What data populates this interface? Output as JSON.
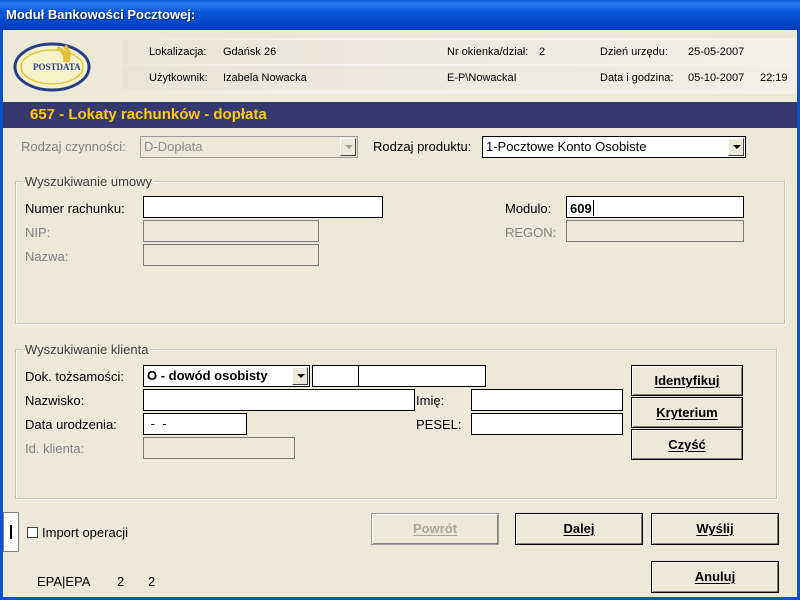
{
  "window": {
    "title": "Moduł Bankowości Pocztowej:"
  },
  "logo": {
    "text": "POSTDATA"
  },
  "header": {
    "lokalizacja_label": "Lokalizacja:",
    "lokalizacja_value": "Gdańsk 26",
    "nr_okienka_label": "Nr okienka/dział:",
    "nr_okienka_value": "2",
    "dzien_urzedu_label": "Dzień urzędu:",
    "dzien_urzedu_value": "25-05-2007",
    "uzytkownik_label": "Użytkownik:",
    "uzytkownik_value": "Izabela Nowacka",
    "login_value": "E-P\\NowackaI",
    "data_godzina_label": "Data i godzina:",
    "data_value": "05-10-2007",
    "godzina_value": "22:19"
  },
  "banner": {
    "title": "657 - Lokaty rachunków - dopłata"
  },
  "top": {
    "rodzaj_czynnosci_label": "Rodzaj czynności:",
    "rodzaj_czynnosci_value": "D-Dopłata",
    "rodzaj_produktu_label": "Rodzaj produktu:",
    "rodzaj_produktu_value": "1-Pocztowe Konto Osobiste"
  },
  "umowa": {
    "title": "Wyszukiwanie umowy",
    "numer_rachunku_label": "Numer rachunku:",
    "numer_rachunku_value": "",
    "nip_label": "NIP:",
    "nip_value": "",
    "nazwa_label": "Nazwa:",
    "nazwa_value": "",
    "modulo_label": "Modulo:",
    "modulo_value": "609",
    "regon_label": "REGON:",
    "regon_value": ""
  },
  "klient": {
    "title": "Wyszukiwanie klienta",
    "dok_label": "Dok. tożsamości:",
    "dok_value": "O - dowód osobisty",
    "dok_seria": "",
    "dok_numer": "",
    "nazwisko_label": "Nazwisko:",
    "nazwisko_value": "",
    "imie_label": "Imię:",
    "imie_value": "",
    "data_urodzenia_label": "Data urodzenia:",
    "data_urodzenia_value": " -  -",
    "pesel_label": "PESEL:",
    "pesel_value": "",
    "id_klienta_label": "Id. klienta:",
    "id_klienta_value": "",
    "btn_identyfikuj": "Identyfikuj",
    "btn_kryterium": "Kryterium",
    "btn_czysc": "Czyść"
  },
  "footer": {
    "import_label": "Import operacji",
    "import_checked": false,
    "btn_powrot": "Powrót",
    "btn_dalej": "Dalej",
    "btn_wyslij": "Wyślij",
    "btn_anuluj": "Anuluj",
    "status_epa": "EPA|EPA",
    "status_1": "2",
    "status_2": "2"
  }
}
